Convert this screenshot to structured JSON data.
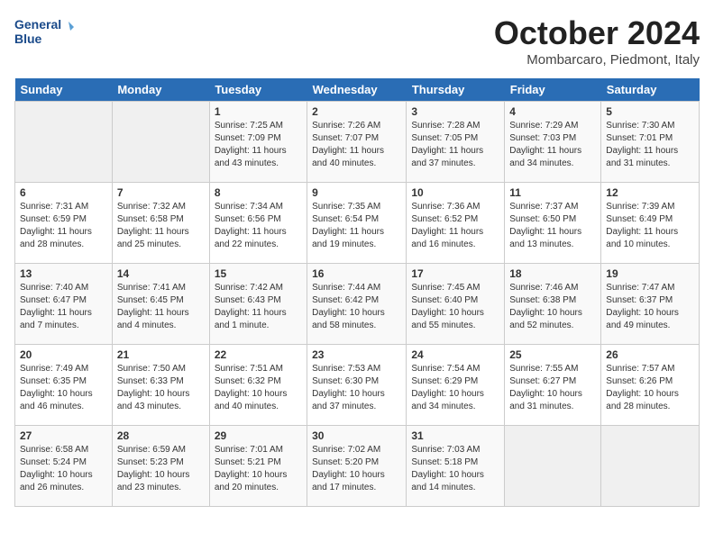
{
  "logo": {
    "line1": "General",
    "line2": "Blue"
  },
  "title": "October 2024",
  "location": "Mombarcaro, Piedmont, Italy",
  "days_header": [
    "Sunday",
    "Monday",
    "Tuesday",
    "Wednesday",
    "Thursday",
    "Friday",
    "Saturday"
  ],
  "weeks": [
    [
      {
        "day": "",
        "sunrise": "",
        "sunset": "",
        "daylight": ""
      },
      {
        "day": "",
        "sunrise": "",
        "sunset": "",
        "daylight": ""
      },
      {
        "day": "1",
        "sunrise": "Sunrise: 7:25 AM",
        "sunset": "Sunset: 7:09 PM",
        "daylight": "Daylight: 11 hours and 43 minutes."
      },
      {
        "day": "2",
        "sunrise": "Sunrise: 7:26 AM",
        "sunset": "Sunset: 7:07 PM",
        "daylight": "Daylight: 11 hours and 40 minutes."
      },
      {
        "day": "3",
        "sunrise": "Sunrise: 7:28 AM",
        "sunset": "Sunset: 7:05 PM",
        "daylight": "Daylight: 11 hours and 37 minutes."
      },
      {
        "day": "4",
        "sunrise": "Sunrise: 7:29 AM",
        "sunset": "Sunset: 7:03 PM",
        "daylight": "Daylight: 11 hours and 34 minutes."
      },
      {
        "day": "5",
        "sunrise": "Sunrise: 7:30 AM",
        "sunset": "Sunset: 7:01 PM",
        "daylight": "Daylight: 11 hours and 31 minutes."
      }
    ],
    [
      {
        "day": "6",
        "sunrise": "Sunrise: 7:31 AM",
        "sunset": "Sunset: 6:59 PM",
        "daylight": "Daylight: 11 hours and 28 minutes."
      },
      {
        "day": "7",
        "sunrise": "Sunrise: 7:32 AM",
        "sunset": "Sunset: 6:58 PM",
        "daylight": "Daylight: 11 hours and 25 minutes."
      },
      {
        "day": "8",
        "sunrise": "Sunrise: 7:34 AM",
        "sunset": "Sunset: 6:56 PM",
        "daylight": "Daylight: 11 hours and 22 minutes."
      },
      {
        "day": "9",
        "sunrise": "Sunrise: 7:35 AM",
        "sunset": "Sunset: 6:54 PM",
        "daylight": "Daylight: 11 hours and 19 minutes."
      },
      {
        "day": "10",
        "sunrise": "Sunrise: 7:36 AM",
        "sunset": "Sunset: 6:52 PM",
        "daylight": "Daylight: 11 hours and 16 minutes."
      },
      {
        "day": "11",
        "sunrise": "Sunrise: 7:37 AM",
        "sunset": "Sunset: 6:50 PM",
        "daylight": "Daylight: 11 hours and 13 minutes."
      },
      {
        "day": "12",
        "sunrise": "Sunrise: 7:39 AM",
        "sunset": "Sunset: 6:49 PM",
        "daylight": "Daylight: 11 hours and 10 minutes."
      }
    ],
    [
      {
        "day": "13",
        "sunrise": "Sunrise: 7:40 AM",
        "sunset": "Sunset: 6:47 PM",
        "daylight": "Daylight: 11 hours and 7 minutes."
      },
      {
        "day": "14",
        "sunrise": "Sunrise: 7:41 AM",
        "sunset": "Sunset: 6:45 PM",
        "daylight": "Daylight: 11 hours and 4 minutes."
      },
      {
        "day": "15",
        "sunrise": "Sunrise: 7:42 AM",
        "sunset": "Sunset: 6:43 PM",
        "daylight": "Daylight: 11 hours and 1 minute."
      },
      {
        "day": "16",
        "sunrise": "Sunrise: 7:44 AM",
        "sunset": "Sunset: 6:42 PM",
        "daylight": "Daylight: 10 hours and 58 minutes."
      },
      {
        "day": "17",
        "sunrise": "Sunrise: 7:45 AM",
        "sunset": "Sunset: 6:40 PM",
        "daylight": "Daylight: 10 hours and 55 minutes."
      },
      {
        "day": "18",
        "sunrise": "Sunrise: 7:46 AM",
        "sunset": "Sunset: 6:38 PM",
        "daylight": "Daylight: 10 hours and 52 minutes."
      },
      {
        "day": "19",
        "sunrise": "Sunrise: 7:47 AM",
        "sunset": "Sunset: 6:37 PM",
        "daylight": "Daylight: 10 hours and 49 minutes."
      }
    ],
    [
      {
        "day": "20",
        "sunrise": "Sunrise: 7:49 AM",
        "sunset": "Sunset: 6:35 PM",
        "daylight": "Daylight: 10 hours and 46 minutes."
      },
      {
        "day": "21",
        "sunrise": "Sunrise: 7:50 AM",
        "sunset": "Sunset: 6:33 PM",
        "daylight": "Daylight: 10 hours and 43 minutes."
      },
      {
        "day": "22",
        "sunrise": "Sunrise: 7:51 AM",
        "sunset": "Sunset: 6:32 PM",
        "daylight": "Daylight: 10 hours and 40 minutes."
      },
      {
        "day": "23",
        "sunrise": "Sunrise: 7:53 AM",
        "sunset": "Sunset: 6:30 PM",
        "daylight": "Daylight: 10 hours and 37 minutes."
      },
      {
        "day": "24",
        "sunrise": "Sunrise: 7:54 AM",
        "sunset": "Sunset: 6:29 PM",
        "daylight": "Daylight: 10 hours and 34 minutes."
      },
      {
        "day": "25",
        "sunrise": "Sunrise: 7:55 AM",
        "sunset": "Sunset: 6:27 PM",
        "daylight": "Daylight: 10 hours and 31 minutes."
      },
      {
        "day": "26",
        "sunrise": "Sunrise: 7:57 AM",
        "sunset": "Sunset: 6:26 PM",
        "daylight": "Daylight: 10 hours and 28 minutes."
      }
    ],
    [
      {
        "day": "27",
        "sunrise": "Sunrise: 6:58 AM",
        "sunset": "Sunset: 5:24 PM",
        "daylight": "Daylight: 10 hours and 26 minutes."
      },
      {
        "day": "28",
        "sunrise": "Sunrise: 6:59 AM",
        "sunset": "Sunset: 5:23 PM",
        "daylight": "Daylight: 10 hours and 23 minutes."
      },
      {
        "day": "29",
        "sunrise": "Sunrise: 7:01 AM",
        "sunset": "Sunset: 5:21 PM",
        "daylight": "Daylight: 10 hours and 20 minutes."
      },
      {
        "day": "30",
        "sunrise": "Sunrise: 7:02 AM",
        "sunset": "Sunset: 5:20 PM",
        "daylight": "Daylight: 10 hours and 17 minutes."
      },
      {
        "day": "31",
        "sunrise": "Sunrise: 7:03 AM",
        "sunset": "Sunset: 5:18 PM",
        "daylight": "Daylight: 10 hours and 14 minutes."
      },
      {
        "day": "",
        "sunrise": "",
        "sunset": "",
        "daylight": ""
      },
      {
        "day": "",
        "sunrise": "",
        "sunset": "",
        "daylight": ""
      }
    ]
  ]
}
